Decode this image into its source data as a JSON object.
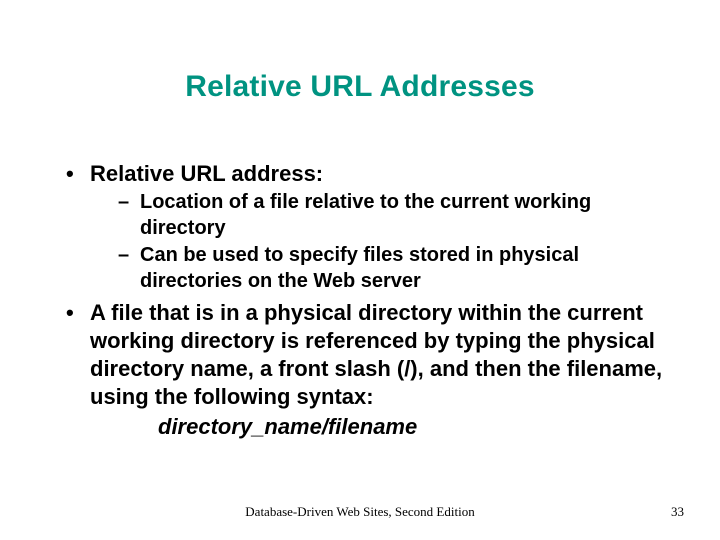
{
  "title": "Relative URL Addresses",
  "bullets": {
    "b1": "Relative URL address:",
    "b1_sub1": "Location of a file relative to the current working directory",
    "b1_sub2": "Can be used to specify files stored in physical directories on the Web server",
    "b2": "A file that is in a physical directory within the current working directory is referenced by typing the physical directory name, a front slash (/), and then the filename, using the following syntax:",
    "b2_syntax": "directory_name/filename"
  },
  "footer": {
    "center": "Database-Driven Web Sites, Second Edition",
    "page": "33"
  }
}
